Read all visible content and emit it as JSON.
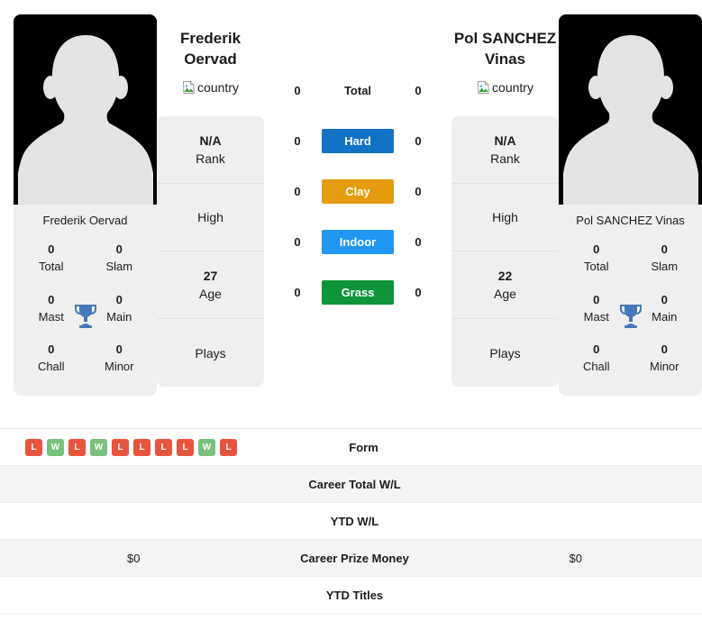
{
  "players": {
    "left": {
      "name_line1": "Frederik",
      "name_line2": "Oervad",
      "full_name": "Frederik Oervad",
      "country_alt": "country",
      "rank_value": "N/A",
      "rank_label": "Rank",
      "high_label": "High",
      "high_value": "",
      "age_value": "27",
      "age_label": "Age",
      "plays_label": "Plays",
      "plays_value": "",
      "titles": {
        "total_value": "0",
        "total_label": "Total",
        "slam_value": "0",
        "slam_label": "Slam",
        "mast_value": "0",
        "mast_label": "Mast",
        "main_value": "0",
        "main_label": "Main",
        "chall_value": "0",
        "chall_label": "Chall",
        "minor_value": "0",
        "minor_label": "Minor"
      }
    },
    "right": {
      "name_line1": "Pol SANCHEZ",
      "name_line2": "Vinas",
      "full_name": "Pol SANCHEZ Vinas",
      "country_alt": "country",
      "rank_value": "N/A",
      "rank_label": "Rank",
      "high_label": "High",
      "high_value": "",
      "age_value": "22",
      "age_label": "Age",
      "plays_label": "Plays",
      "plays_value": "",
      "titles": {
        "total_value": "0",
        "total_label": "Total",
        "slam_value": "0",
        "slam_label": "Slam",
        "mast_value": "0",
        "mast_label": "Mast",
        "main_value": "0",
        "main_label": "Main",
        "chall_value": "0",
        "chall_label": "Chall",
        "minor_value": "0",
        "minor_label": "Minor"
      }
    }
  },
  "surfaces": [
    {
      "label": "Total",
      "left": "0",
      "right": "0",
      "color": "transparent",
      "text_color": "#1c1c1c",
      "plain": true
    },
    {
      "label": "Hard",
      "left": "0",
      "right": "0",
      "color": "#1273c6",
      "text_color": "#ffffff",
      "plain": false
    },
    {
      "label": "Clay",
      "left": "0",
      "right": "0",
      "color": "#e49b0f",
      "text_color": "#ffffff",
      "plain": false
    },
    {
      "label": "Indoor",
      "left": "0",
      "right": "0",
      "color": "#2196f3",
      "text_color": "#ffffff",
      "plain": false
    },
    {
      "label": "Grass",
      "left": "0",
      "right": "0",
      "color": "#10953b",
      "text_color": "#ffffff",
      "plain": false
    }
  ],
  "stats_rows": [
    {
      "label": "Form",
      "left": "",
      "right": "",
      "is_form": true
    },
    {
      "label": "Career Total W/L",
      "left": "",
      "right": "",
      "is_form": false
    },
    {
      "label": "YTD W/L",
      "left": "",
      "right": "",
      "is_form": false
    },
    {
      "label": "Career Prize Money",
      "left": "$0",
      "right": "$0",
      "is_form": false
    },
    {
      "label": "YTD Titles",
      "left": "",
      "right": "",
      "is_form": false
    }
  ],
  "form_left": [
    "L",
    "W",
    "L",
    "W",
    "L",
    "L",
    "L",
    "L",
    "W",
    "L"
  ],
  "form_right": [],
  "colors": {
    "win": "#78c07d",
    "loss": "#e8553f",
    "trophy": "#4478b8",
    "card_bg": "#efefef",
    "row_alt": "#f4f4f4"
  }
}
